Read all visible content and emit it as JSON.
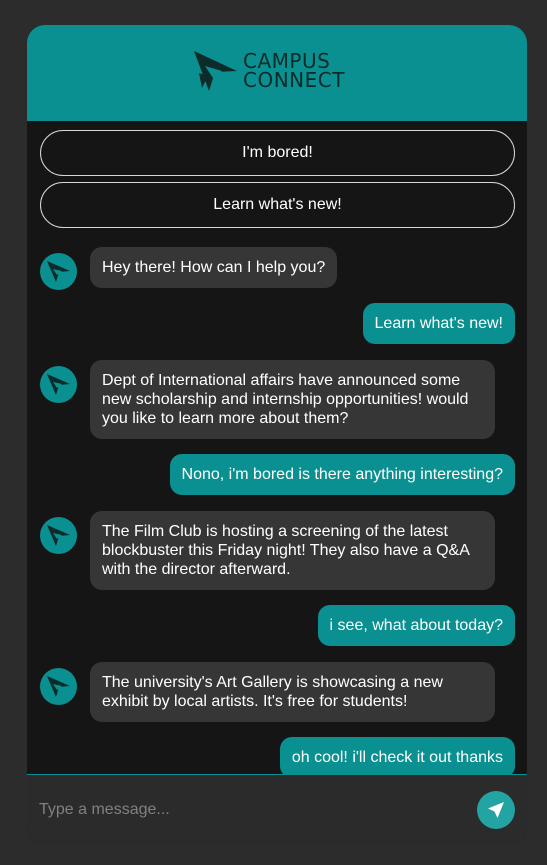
{
  "brand": {
    "line1": "CAMPUS",
    "line2": "CONNECT"
  },
  "quick_replies": [
    "I'm bored!",
    "Learn what's new!"
  ],
  "messages": [
    {
      "sender": "bot",
      "text": "Hey there! How can I help you?"
    },
    {
      "sender": "user",
      "text": "Learn what's new!"
    },
    {
      "sender": "bot",
      "text": "Dept of International affairs have announced some new scholarship and internship opportunities! would you like to learn more about them?"
    },
    {
      "sender": "user",
      "text": "Nono, i'm bored is there anything interesting?"
    },
    {
      "sender": "bot",
      "text": "The Film Club is hosting a screening of the latest blockbuster this Friday night! They also have a Q&A with the director afterward."
    },
    {
      "sender": "user",
      "text": "i see, what about today?"
    },
    {
      "sender": "bot",
      "text": "The university's Art Gallery is showcasing a new exhibit by local artists. It's free for students!"
    },
    {
      "sender": "user",
      "text": "oh cool! i'll check it out thanks"
    }
  ],
  "composer": {
    "placeholder": "Type a message..."
  },
  "colors": {
    "accent": "#0a9090",
    "page": "#2c2c2c",
    "panel": "#151515",
    "bot_bubble": "#363636"
  },
  "icons": {
    "logo": "campus-connect-logo",
    "avatar": "bot-avatar-icon",
    "send": "send-arrow-icon"
  }
}
